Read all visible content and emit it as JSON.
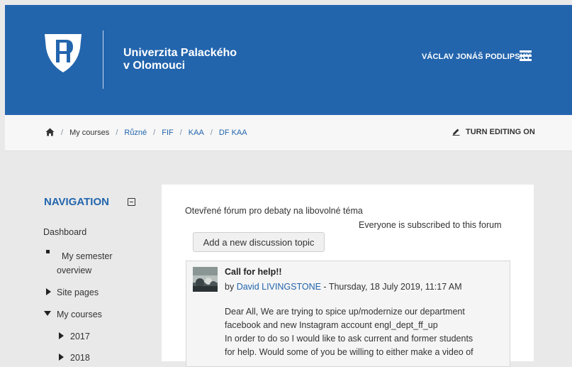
{
  "header": {
    "university_line1": "Univerzita Palackého",
    "university_line2": "v Olomouci",
    "user_name": "VÁCLAV JONÁŠ PODLIPSKÝ",
    "menu_icon": "hamburger-icon",
    "bg_color": "#2365ad"
  },
  "breadcrumb": {
    "home_icon": "home-icon",
    "items": [
      "My courses",
      "Různé",
      "FIF",
      "KAA",
      "DF KAA"
    ],
    "edit_label": "TURN EDITING ON"
  },
  "navigation": {
    "title": "NAVIGATION",
    "dashboard": "Dashboard",
    "semester_line1": "My semester",
    "semester_line2": "overview",
    "site_pages": "Site pages",
    "my_courses": "My courses",
    "year1": "2017",
    "year2": "2018"
  },
  "forum": {
    "description": "Otevřené fórum pro debaty na libovolné téma",
    "subscribed": "Everyone is subscribed to this forum",
    "add_button": "Add a new discussion topic"
  },
  "post": {
    "title": "Call for help!!",
    "by": "by",
    "author": "David LIVINGSTONE",
    "date": " - Thursday, 18 July 2019, 11:17 AM",
    "line1": "Dear All, We are trying to spice up/modernize our department",
    "line2": "facebook and new Instagram account engl_dept_ff_up",
    "line3": "In order to do so I would like to ask current and former students",
    "line4": "for help. Would some of you be willing to either make a video of"
  }
}
